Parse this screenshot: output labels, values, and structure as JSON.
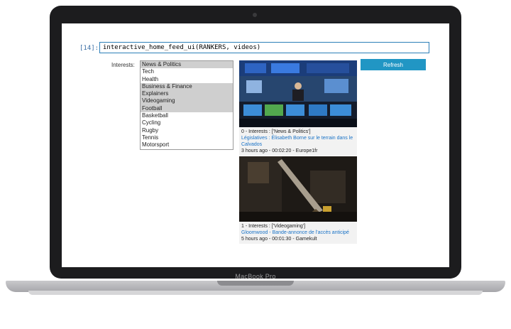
{
  "device": {
    "label": "MacBook Pro"
  },
  "cell": {
    "prompt": "[14]:",
    "code": "interactive_home_feed_ui(RANKERS, videos)"
  },
  "interests": {
    "label": "Interests:",
    "options": [
      {
        "label": "News & Politics",
        "selected": true
      },
      {
        "label": "Tech",
        "selected": false
      },
      {
        "label": "Health",
        "selected": false
      },
      {
        "label": "Business & Finance",
        "selected": true
      },
      {
        "label": "Explainers",
        "selected": true
      },
      {
        "label": "Videogaming",
        "selected": true
      },
      {
        "label": "Football",
        "selected": true
      },
      {
        "label": "Basketball",
        "selected": false
      },
      {
        "label": "Cycling",
        "selected": false
      },
      {
        "label": "Rugby",
        "selected": false
      },
      {
        "label": "Tennis",
        "selected": false
      },
      {
        "label": "Motorsport",
        "selected": false
      }
    ]
  },
  "refresh": {
    "label": "Refresh"
  },
  "videos": [
    {
      "meta": "0 - Interests : ['News & Politics']",
      "title": "Législatives : Élisabeth Borne sur le terrain dans le Calvados",
      "info": "3 hours ago - 00:02:20 - Europe1fr"
    },
    {
      "meta": "1 - Interests : ['Videogaming']",
      "title": "Gloomwood - Bande-annonce de l'accès anticipé",
      "info": "5 hours ago - 00:01:30 - Gamekult"
    }
  ],
  "colors": {
    "accent": "#2196c4",
    "link": "#1a73c7",
    "selected": "#cfcfcf"
  }
}
